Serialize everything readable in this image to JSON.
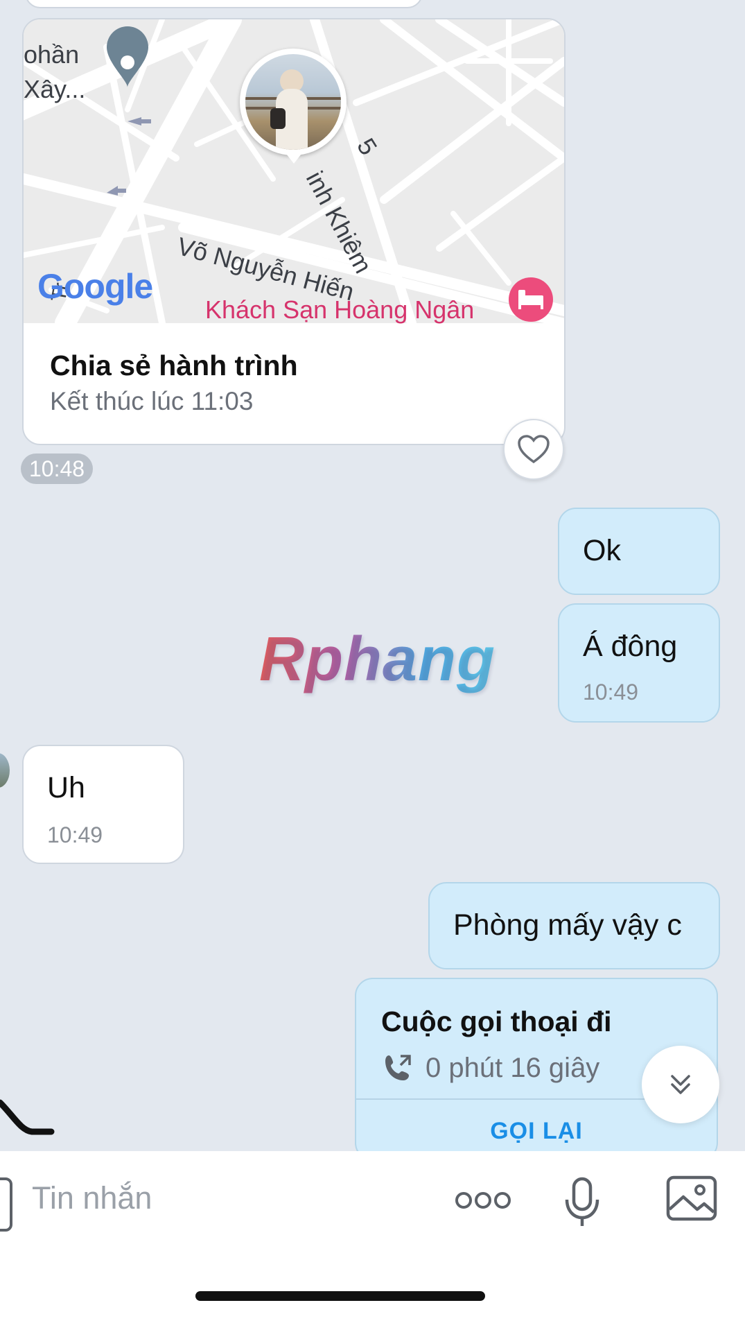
{
  "location_card": {
    "map_labels": {
      "top_left_line1": "ohần",
      "top_left_line2": "Xây...",
      "street_main": "Võ Nguyễn Hiến",
      "street_cross": "inh Khiêm",
      "street_number": "5",
      "hotel": "Khách Sạn Hoàng Ngân",
      "left_edge": "Tr",
      "provider_logo": "Google"
    },
    "title": "Chia sẻ hành trình",
    "subtitle": "Kết thúc lúc 11:03",
    "time": "10:48"
  },
  "messages": [
    {
      "direction": "out",
      "text": "Ok"
    },
    {
      "direction": "out",
      "text": "Á đông",
      "time": "10:49"
    },
    {
      "direction": "in",
      "text": "Uh",
      "time": "10:49"
    },
    {
      "direction": "out",
      "text": "Phòng mấy vậy c"
    }
  ],
  "call_card": {
    "title": "Cuộc gọi thoại đi",
    "duration": "0 phút 16 giây",
    "action": "GỌI LẠI"
  },
  "watermark": "Rphang",
  "input_bar": {
    "placeholder": "Tin nhắn",
    "icons": [
      "more-icon",
      "microphone-icon",
      "image-icon"
    ]
  },
  "colors": {
    "background": "#e3e8ef",
    "outgoing_bubble": "#d2ecfb",
    "incoming_bubble": "#ffffff",
    "accent": "#1a8ee6",
    "hotel_pin": "#ec4c7c"
  }
}
